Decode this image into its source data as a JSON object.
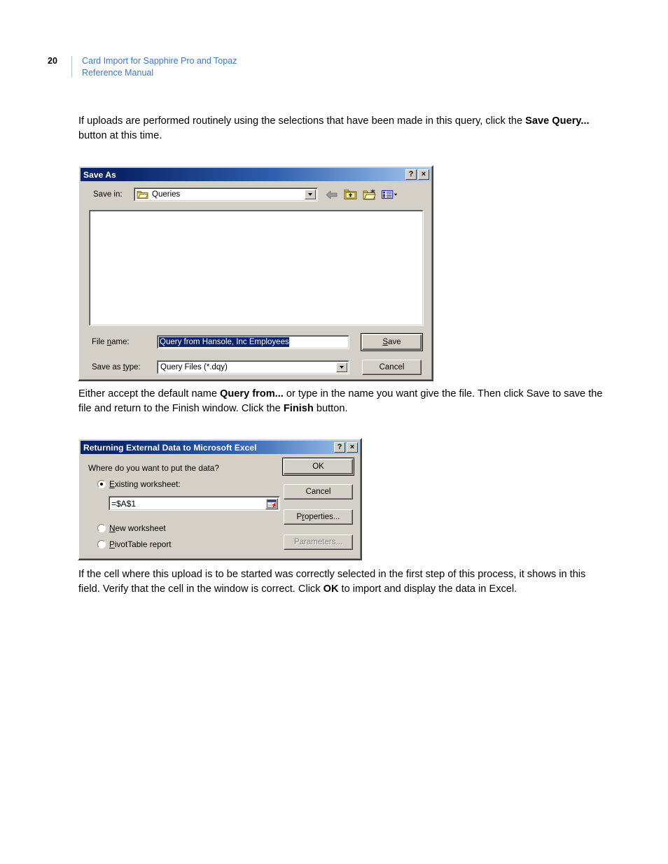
{
  "header": {
    "page_number": "20",
    "title_line1": "Card Import for Sapphire Pro and Topaz",
    "title_line2": "Reference Manual",
    "accent_color": "#3f76bd"
  },
  "body": {
    "para1_a": "If uploads are performed routinely using the selections that have been made in this query, click the ",
    "para1_bold": "Save Query...",
    "para1_b": " button at this time.",
    "para2_a": "Either accept the default name ",
    "para2_bold1": "Query from...",
    "para2_b": " or type in the name you want give the file. Then click Save to save the file and return to the Finish window. Click the ",
    "para2_bold2": "Finish",
    "para2_c": " button.",
    "para3_a": "If the cell where this upload is to be started was correctly selected in the first step of this process, it shows in this field. Verify that the cell in the window is correct. Click ",
    "para3_bold": "OK",
    "para3_b": " to import and display the data in Excel."
  },
  "save_as_dialog": {
    "title": "Save As",
    "help_button": "?",
    "close_button": "×",
    "save_in_label": "Save in:",
    "save_in_value": "Queries",
    "toolbar": {
      "back": "back-arrow-icon",
      "up_one_level": "up-one-level-icon",
      "new_folder": "new-folder-icon",
      "views": "views-icon"
    },
    "file_list_items": [],
    "file_name_label": "File name:",
    "file_name_value": "Query from Hansole, Inc Employees",
    "save_as_type_label": "Save as type:",
    "save_as_type_value": "Query Files (*.dqy)",
    "save_as_type_options": [
      "Query Files (*.dqy)"
    ],
    "save_button": "Save",
    "save_button_accel": "S",
    "cancel_button": "Cancel",
    "selection_color": "#0a246a"
  },
  "return_dialog": {
    "title": "Returning External Data to Microsoft Excel",
    "help_button": "?",
    "close_button": "×",
    "prompt": "Where do you want to put the data?",
    "options": [
      {
        "label": "Existing worksheet:",
        "accel": "E",
        "selected": true
      },
      {
        "label": "New worksheet",
        "accel": "N",
        "selected": false
      },
      {
        "label": "PivotTable report",
        "accel": "P",
        "selected": false
      }
    ],
    "range_value": "=$A$1",
    "range_picker_icon": "range-selector-icon",
    "ok_button": "OK",
    "cancel_button": "Cancel",
    "properties_button": "Properties...",
    "properties_accel": "r",
    "parameters_button": "Parameters...",
    "parameters_disabled": true
  }
}
